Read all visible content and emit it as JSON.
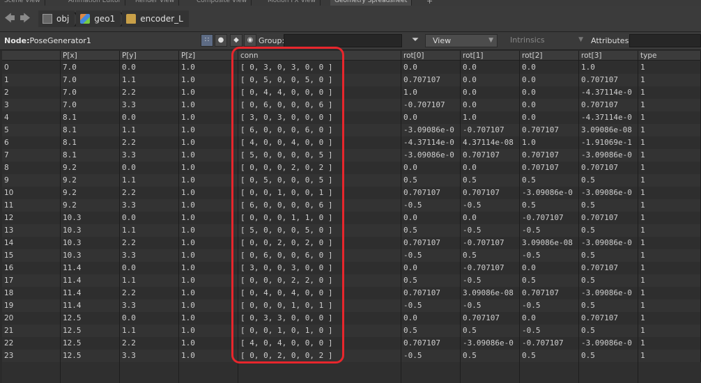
{
  "tabs": [
    "Scene View",
    "Animation Editor",
    "Render View",
    "Composite View",
    "Motion FX View",
    "Geometry Spreadsheet"
  ],
  "path": [
    {
      "label": "obj",
      "icon": "obj-icon"
    },
    {
      "label": "geo1",
      "icon": "geometry-icon"
    },
    {
      "label": "encoder_L",
      "icon": "subnet-icon"
    }
  ],
  "toolbar": {
    "node_prefix": "Node:",
    "node_name": "PoseGenerator1",
    "group_label": "Group:",
    "group_value": "",
    "view_label": "View",
    "intrinsics_label": "Intrinsics",
    "attributes_label": "Attributes:",
    "attributes_value": ""
  },
  "columns": [
    "",
    "P[x]",
    "P[y]",
    "P[z]",
    "conn",
    "rot[0]",
    "rot[1]",
    "rot[2]",
    "rot[3]",
    "type"
  ],
  "rows": [
    [
      "0",
      "7.0",
      "0.0",
      "1.0",
      "[ 0, 3, 0, 3, 0, 0 ]",
      "0.0",
      "0.0",
      "0.0",
      "1.0",
      "1"
    ],
    [
      "1",
      "7.0",
      "1.1",
      "1.0",
      "[ 0, 5, 0, 0, 5, 0 ]",
      "0.707107",
      "0.0",
      "0.0",
      "0.707107",
      "1"
    ],
    [
      "2",
      "7.0",
      "2.2",
      "1.0",
      "[ 0, 4, 4, 0, 0, 0 ]",
      "1.0",
      "0.0",
      "0.0",
      "-4.37114e-0",
      "1"
    ],
    [
      "3",
      "7.0",
      "3.3",
      "1.0",
      "[ 0, 6, 0, 0, 0, 6 ]",
      "-0.707107",
      "0.0",
      "0.0",
      "0.707107",
      "1"
    ],
    [
      "4",
      "8.1",
      "0.0",
      "1.0",
      "[ 3, 0, 3, 0, 0, 0 ]",
      "0.0",
      "1.0",
      "0.0",
      "-4.37114e-0",
      "1"
    ],
    [
      "5",
      "8.1",
      "1.1",
      "1.0",
      "[ 6, 0, 0, 0, 6, 0 ]",
      "-3.09086e-0",
      "-0.707107",
      "0.707107",
      "3.09086e-08",
      "1"
    ],
    [
      "6",
      "8.1",
      "2.2",
      "1.0",
      "[ 4, 0, 0, 4, 0, 0 ]",
      "-4.37114e-0",
      "4.37114e-08",
      "1.0",
      "-1.91069e-1",
      "1"
    ],
    [
      "7",
      "8.1",
      "3.3",
      "1.0",
      "[ 5, 0, 0, 0, 0, 5 ]",
      "-3.09086e-0",
      "0.707107",
      "0.707107",
      "-3.09086e-0",
      "1"
    ],
    [
      "8",
      "9.2",
      "0.0",
      "1.0",
      "[ 0, 0, 0, 2, 0, 2 ]",
      "0.0",
      "0.0",
      "0.707107",
      "0.707107",
      "1"
    ],
    [
      "9",
      "9.2",
      "1.1",
      "1.0",
      "[ 0, 5, 0, 0, 0, 5 ]",
      "0.5",
      "0.5",
      "0.5",
      "0.5",
      "1"
    ],
    [
      "10",
      "9.2",
      "2.2",
      "1.0",
      "[ 0, 0, 1, 0, 0, 1 ]",
      "0.707107",
      "0.707107",
      "-3.09086e-0",
      "-3.09086e-0",
      "1"
    ],
    [
      "11",
      "9.2",
      "3.3",
      "1.0",
      "[ 6, 0, 0, 0, 0, 6 ]",
      "-0.5",
      "-0.5",
      "0.5",
      "0.5",
      "1"
    ],
    [
      "12",
      "10.3",
      "0.0",
      "1.0",
      "[ 0, 0, 0, 1, 1, 0 ]",
      "0.0",
      "0.0",
      "-0.707107",
      "0.707107",
      "1"
    ],
    [
      "13",
      "10.3",
      "1.1",
      "1.0",
      "[ 5, 0, 0, 0, 5, 0 ]",
      "0.5",
      "-0.5",
      "-0.5",
      "0.5",
      "1"
    ],
    [
      "14",
      "10.3",
      "2.2",
      "1.0",
      "[ 0, 0, 2, 0, 2, 0 ]",
      "0.707107",
      "-0.707107",
      "3.09086e-08",
      "-3.09086e-0",
      "1"
    ],
    [
      "15",
      "10.3",
      "3.3",
      "1.0",
      "[ 0, 6, 0, 0, 6, 0 ]",
      "-0.5",
      "0.5",
      "-0.5",
      "0.5",
      "1"
    ],
    [
      "16",
      "11.4",
      "0.0",
      "1.0",
      "[ 3, 0, 0, 3, 0, 0 ]",
      "0.0",
      "-0.707107",
      "0.0",
      "0.707107",
      "1"
    ],
    [
      "17",
      "11.4",
      "1.1",
      "1.0",
      "[ 0, 0, 0, 2, 2, 0 ]",
      "0.5",
      "-0.5",
      "0.5",
      "0.5",
      "1"
    ],
    [
      "18",
      "11.4",
      "2.2",
      "1.0",
      "[ 0, 4, 0, 4, 0, 0 ]",
      "0.707107",
      "3.09086e-08",
      "0.707107",
      "-3.09086e-0",
      "1"
    ],
    [
      "19",
      "11.4",
      "3.3",
      "1.0",
      "[ 0, 0, 0, 1, 0, 1 ]",
      "-0.5",
      "-0.5",
      "-0.5",
      "0.5",
      "1"
    ],
    [
      "20",
      "12.5",
      "0.0",
      "1.0",
      "[ 0, 3, 3, 0, 0, 0 ]",
      "0.0",
      "0.707107",
      "0.0",
      "0.707107",
      "1"
    ],
    [
      "21",
      "12.5",
      "1.1",
      "1.0",
      "[ 0, 0, 1, 0, 1, 0 ]",
      "0.5",
      "0.5",
      "-0.5",
      "0.5",
      "1"
    ],
    [
      "22",
      "12.5",
      "2.2",
      "1.0",
      "[ 4, 0, 4, 0, 0, 0 ]",
      "0.707107",
      "-3.09086e-0",
      "-0.707107",
      "-3.09086e-0",
      "1"
    ],
    [
      "23",
      "12.5",
      "3.3",
      "1.0",
      "[ 0, 0, 2, 0, 0, 2 ]",
      "-0.5",
      "0.5",
      "0.5",
      "0.5",
      "1"
    ]
  ],
  "colors": {
    "background": "#2b2b2b",
    "annotation": "#e8262c"
  }
}
